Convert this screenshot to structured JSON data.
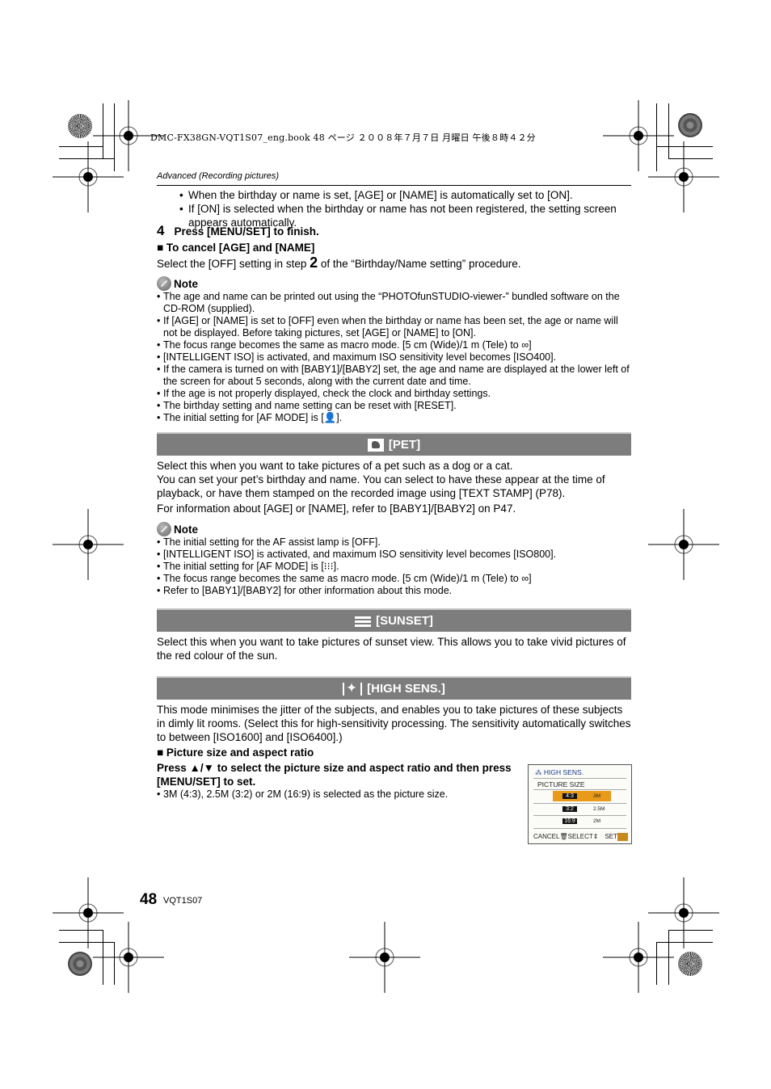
{
  "book_header": "DMC-FX38GN-VQT1S07_eng.book  48 ページ  ２００８年７月７日  月曜日  午後８時４２分",
  "running_head": "Advanced (Recording pictures)",
  "top_bullets": [
    "When the birthday or name is set, [AGE] or [NAME] is automatically set to [ON].",
    "If [ON] is selected when the birthday or name has not been registered, the setting screen appears automatically."
  ],
  "step4": {
    "number": "4",
    "text": "Press [MENU/SET] to finish."
  },
  "cancel_section": {
    "heading": "To cancel [AGE] and [NAME]",
    "text_before": "Select the [OFF] setting in step ",
    "step_digit": "2",
    "text_after": " of the “Birthday/Name setting” procedure."
  },
  "note1": {
    "heading": "Note",
    "items": [
      "The age and name can be printed out using the “PHOTOfunSTUDIO-viewer-” bundled software on the CD-ROM (supplied).",
      "If [AGE] or [NAME] is set to [OFF] even when the birthday or name has been set, the age or name will not be displayed. Before taking pictures, set [AGE] or [NAME] to [ON].",
      "The focus range becomes the same as macro mode. [5 cm (Wide)/1 m (Tele) to ∞]",
      "[INTELLIGENT ISO] is activated, and maximum ISO sensitivity level becomes [ISO400].",
      "If the camera is turned on with [BABY1]/[BABY2] set, the age and name are displayed at the lower left of the screen for about 5 seconds, along with the current date and time.",
      "If the age is not properly displayed, check the clock and birthday settings.",
      "The birthday setting and name setting can be reset with [RESET].",
      "The initial setting for [AF MODE] is [👤]."
    ]
  },
  "pet": {
    "title": "[PET]",
    "icon": "pet-icon",
    "paragraphs": [
      "Select this when you want to take pictures of a pet such as a dog or a cat.\nYou can set your pet’s birthday and name. You can select to have these appear at the time of playback, or have them stamped on the recorded image using [TEXT STAMP] (P78).",
      "For information about [AGE] or [NAME], refer to [BABY1]/[BABY2] on P47."
    ]
  },
  "note2": {
    "heading": "Note",
    "items": [
      "The initial setting for the AF assist lamp is [OFF].",
      "[INTELLIGENT ISO] is activated, and maximum ISO sensitivity level becomes [ISO800].",
      "The initial setting for [AF MODE] is [⁝⁝⁝].",
      "The focus range becomes the same as macro mode. [5 cm (Wide)/1 m (Tele) to ∞]",
      "Refer to [BABY1]/[BABY2] for other information about this mode."
    ]
  },
  "sunset": {
    "title": "[SUNSET]",
    "icon": "sunset-icon",
    "text": "Select this when you want to take pictures of sunset view. This allows you to take vivid pictures of the red colour of the sun."
  },
  "high_sens": {
    "title": "[HIGH SENS.]",
    "icon": "high-sens-icon",
    "text": "This mode minimises the jitter of the subjects, and enables you to take pictures of these subjects in dimly lit rooms. (Select this for high-sensitivity processing. The sensitivity automatically switches to between [ISO1600] and [ISO6400].)",
    "picture_size_heading": "Picture size and aspect ratio",
    "instruction": "Press ▲/▼ to select the picture size and aspect ratio and then press [MENU/SET] to set.",
    "bullet": "3M (4:3), 2.5M (3:2) or 2M (16:9) is selected as the picture size."
  },
  "lcd_screen": {
    "title": "HIGH SENS.",
    "label": "PICTURE SIZE",
    "rows": [
      {
        "ratio": "4:3",
        "size": "3M",
        "selected": true
      },
      {
        "ratio": "3:2",
        "size": "2.5M",
        "selected": false
      },
      {
        "ratio": "16:9",
        "size": "2M",
        "selected": false
      }
    ],
    "footer": {
      "cancel": "CANCEL",
      "select": "SELECT",
      "set": "SET"
    },
    "highlight_color": "#e99a1a"
  },
  "footer": {
    "page_number": "48",
    "code": "VQT1S07"
  }
}
